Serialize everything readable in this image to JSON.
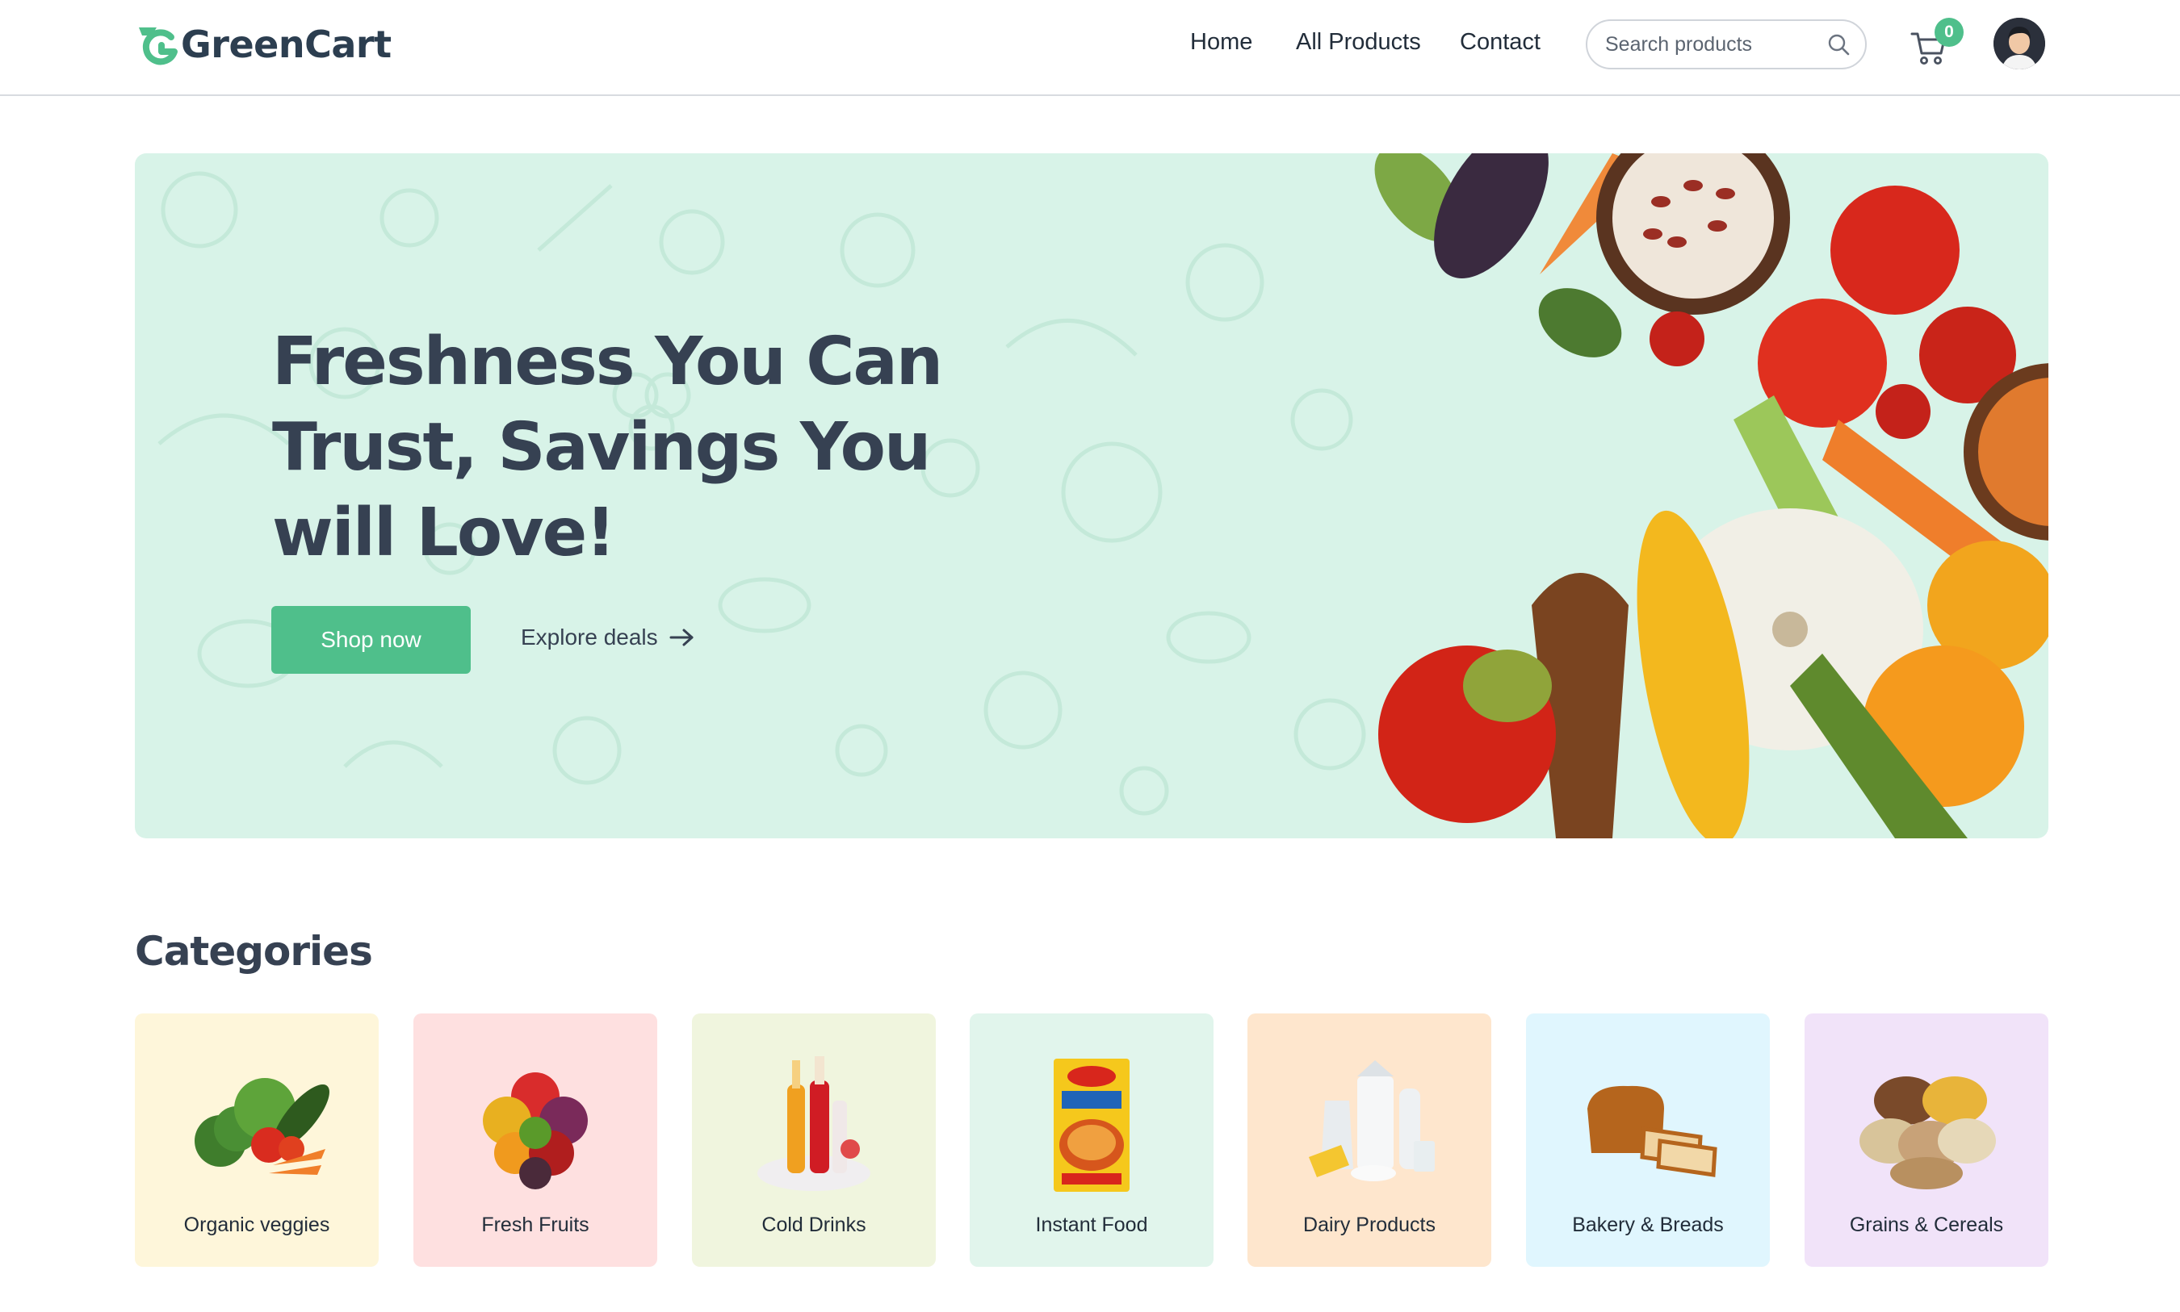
{
  "brand": {
    "name": "GreenCart",
    "logo_icon": "greencart-logo-icon",
    "accent": "#4fbf8b"
  },
  "nav": {
    "links": [
      "Home",
      "All Products",
      "Contact"
    ],
    "search": {
      "placeholder": "Search products",
      "icon": "search-icon"
    },
    "cart": {
      "icon": "cart-icon",
      "count": "0"
    },
    "avatar": {
      "icon": "user-avatar"
    }
  },
  "hero": {
    "title_lines": [
      "Freshness You Can",
      "Trust, Savings You",
      "will Love!"
    ],
    "primary_cta": "Shop now",
    "secondary_cta": "Explore deals",
    "secondary_icon": "arrow-right-icon",
    "background": "#d8f3e8"
  },
  "categories": {
    "title": "Categories",
    "items": [
      {
        "label": "Organic veggies",
        "icon": "vegetables-icon",
        "bg": "#fef6da"
      },
      {
        "label": "Fresh Fruits",
        "icon": "fruits-icon",
        "bg": "#fee0e0"
      },
      {
        "label": "Cold Drinks",
        "icon": "cold-drinks-icon",
        "bg": "#f0f5de"
      },
      {
        "label": "Instant Food",
        "icon": "instant-noodles-icon",
        "bg": "#e1f5ec"
      },
      {
        "label": "Dairy Products",
        "icon": "dairy-icon",
        "bg": "#fee6cd"
      },
      {
        "label": "Bakery & Breads",
        "icon": "bread-icon",
        "bg": "#e0f6fe"
      },
      {
        "label": "Grains & Cereals",
        "icon": "grains-icon",
        "bg": "#f1e3f9"
      }
    ]
  }
}
